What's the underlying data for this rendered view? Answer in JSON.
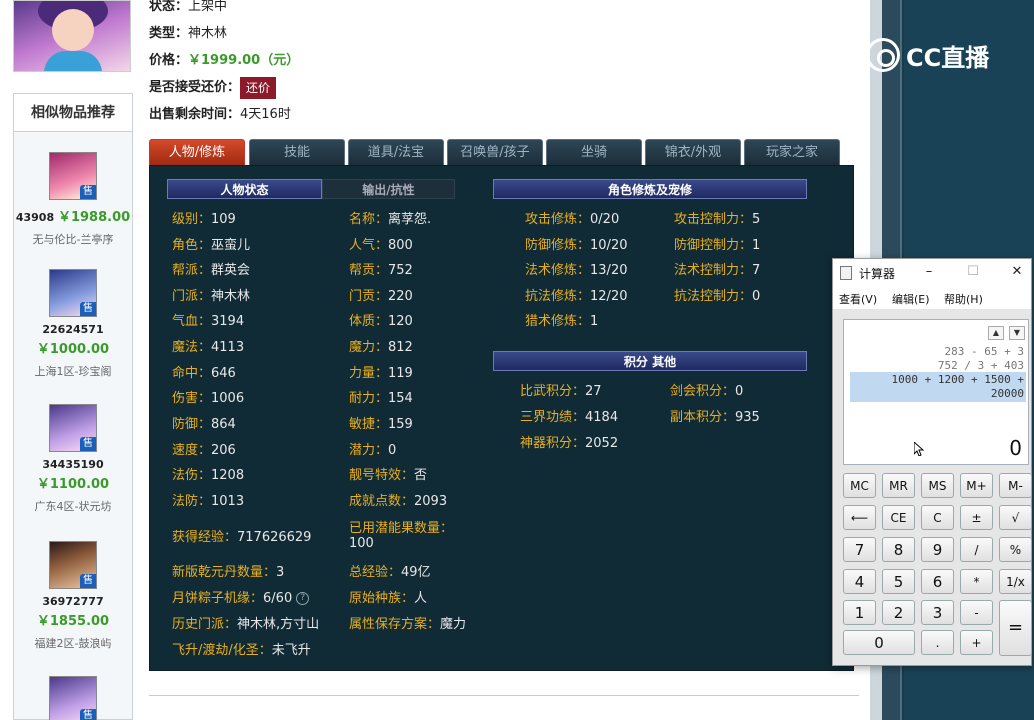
{
  "item": {
    "status_label": "状态：",
    "status_value": "上架中",
    "type_label": "类型：",
    "type_value": "神木林",
    "price_label": "价格：",
    "price_value": "￥1999.00（元）",
    "haggle_label": "是否接受还价：",
    "haggle_button": "还价",
    "remain_label": "出售剩余时间：",
    "remain_value": "4天16时"
  },
  "sidebar": {
    "title": "相似物品推荐",
    "items": [
      {
        "id": "43908",
        "price": "￥1988.00",
        "server": "无与伦比-兰亭序"
      },
      {
        "id": "22624571",
        "price": "￥1000.00",
        "server": "上海1区-珍宝阁"
      },
      {
        "id": "34435190",
        "price": "￥1100.00",
        "server": "广东4区-状元坊"
      },
      {
        "id": "36972777",
        "price": "￥1855.00",
        "server": "福建2区-鼓浪屿"
      }
    ],
    "sell_badge": "售"
  },
  "tabs": [
    "人物/修炼",
    "技能",
    "道具/法宝",
    "召唤兽/孩子",
    "坐骑",
    "锦衣/外观",
    "玩家之家"
  ],
  "sections": {
    "person": "人物状态",
    "attack": "输出/抗性",
    "cultivation": "角色修炼及宠修",
    "points": "积分 其他"
  },
  "left_col": [
    {
      "k": "级别：",
      "v": "109"
    },
    {
      "k": "角色：",
      "v": "巫蛮儿"
    },
    {
      "k": "帮派：",
      "v": "群英会"
    },
    {
      "k": "门派：",
      "v": "神木林"
    },
    {
      "k": "气血：",
      "v": "3194"
    },
    {
      "k": "魔法：",
      "v": "4113"
    },
    {
      "k": "命中：",
      "v": "646"
    },
    {
      "k": "伤害：",
      "v": "1006"
    },
    {
      "k": "防御：",
      "v": "864"
    },
    {
      "k": "速度：",
      "v": "206"
    },
    {
      "k": "法伤：",
      "v": "1208"
    },
    {
      "k": "法防：",
      "v": "1013"
    },
    {
      "k": "获得经验：",
      "v": "717626629"
    },
    {
      "k": "新版乾元丹数量：",
      "v": "3"
    },
    {
      "k": "月饼粽子机缘：",
      "v": "6/60"
    },
    {
      "k": "历史门派：",
      "v": "神木林,方寸山"
    },
    {
      "k": "飞升/渡劫/化圣：",
      "v": "未飞升"
    }
  ],
  "mid_col": [
    {
      "k": "名称：",
      "v": "离莩怨."
    },
    {
      "k": "人气：",
      "v": "800"
    },
    {
      "k": "帮贡：",
      "v": "752"
    },
    {
      "k": "门贡：",
      "v": "220"
    },
    {
      "k": "体质：",
      "v": "120"
    },
    {
      "k": "魔力：",
      "v": "812"
    },
    {
      "k": "力量：",
      "v": "119"
    },
    {
      "k": "耐力：",
      "v": "154"
    },
    {
      "k": "敏捷：",
      "v": "159"
    },
    {
      "k": "潜力：",
      "v": "0"
    },
    {
      "k": "靓号特效：",
      "v": "否"
    },
    {
      "k": "成就点数：",
      "v": "2093"
    },
    {
      "k": "已用潜能果数量：",
      "v": "100"
    },
    {
      "k": "总经验：",
      "v": "49亿"
    },
    {
      "k": "原始种族：",
      "v": "人"
    },
    {
      "k": "属性保存方案：",
      "v": "魔力"
    }
  ],
  "cult_left": [
    {
      "k": "攻击修炼：",
      "v": "0/20"
    },
    {
      "k": "防御修炼：",
      "v": "10/20"
    },
    {
      "k": "法术修炼：",
      "v": "13/20"
    },
    {
      "k": "抗法修炼：",
      "v": "12/20"
    },
    {
      "k": "猎术修炼：",
      "v": "1"
    }
  ],
  "cult_right": [
    {
      "k": "攻击控制力：",
      "v": "5"
    },
    {
      "k": "防御控制力：",
      "v": "1"
    },
    {
      "k": "法术控制力：",
      "v": "7"
    },
    {
      "k": "抗法控制力：",
      "v": "0"
    }
  ],
  "points_left": [
    {
      "k": "比武积分：",
      "v": "27"
    },
    {
      "k": "三界功绩：",
      "v": "4184"
    },
    {
      "k": "神器积分：",
      "v": "2052"
    }
  ],
  "points_right": [
    {
      "k": "剑会积分：",
      "v": "0"
    },
    {
      "k": "副本积分：",
      "v": "935"
    }
  ],
  "calculator": {
    "title": "计算器",
    "menu": [
      "查看(V)",
      "编辑(E)",
      "帮助(H)"
    ],
    "history": [
      "283 - 65 + 3",
      "752 / 3 + 403",
      "1000 + 1200 + 1500 +",
      "20000"
    ],
    "current": "0",
    "keys": [
      [
        "MC",
        "MR",
        "MS",
        "M+",
        "M-"
      ],
      [
        "⟵",
        "CE",
        "C",
        "±",
        "√"
      ],
      [
        "7",
        "8",
        "9",
        "/",
        "%"
      ],
      [
        "4",
        "5",
        "6",
        "*",
        "1/x"
      ],
      [
        "1",
        "2",
        "3",
        "-",
        "="
      ],
      [
        "0",
        ".",
        "+"
      ]
    ]
  },
  "logo_text": "CC直播"
}
